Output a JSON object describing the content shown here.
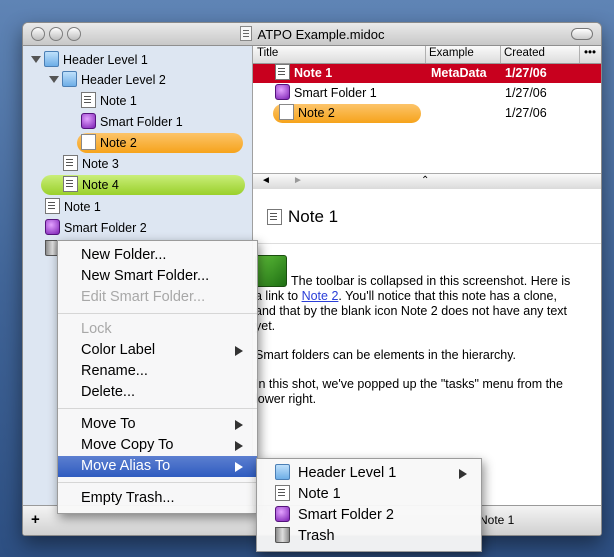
{
  "window": {
    "title": "ATPO Example.midoc"
  },
  "sidebar": {
    "items": [
      {
        "label": "Header Level 1",
        "icon": "folder-icon"
      },
      {
        "label": "Header Level 2",
        "icon": "folder-icon"
      },
      {
        "label": "Note 1",
        "icon": "note-icon"
      },
      {
        "label": "Smart Folder 1",
        "icon": "smart-folder-icon"
      },
      {
        "label": "Note 2",
        "icon": "blank-note-icon",
        "highlight": "#f6a31b"
      },
      {
        "label": "Note 3",
        "icon": "note-icon"
      },
      {
        "label": "Note 4",
        "icon": "note-icon",
        "highlight": "#9ad02b"
      },
      {
        "label": "Note 1",
        "icon": "note-icon"
      },
      {
        "label": "Smart Folder 2",
        "icon": "smart-folder-icon"
      }
    ]
  },
  "list": {
    "columns": [
      "Title",
      "Example",
      "Created",
      "•••"
    ],
    "rows": [
      {
        "title": "Note 1",
        "example": "MetaData",
        "created": "1/27/06",
        "selected": true,
        "color": "#c8001e"
      },
      {
        "title": "Smart Folder 1",
        "example": "",
        "created": "1/27/06"
      },
      {
        "title": "Note 2",
        "example": "",
        "created": "1/27/06",
        "highlight": "#f6a31b"
      }
    ],
    "scroll": {
      "left": "◄",
      "right": "►",
      "up": "⌃"
    }
  },
  "detail": {
    "title": "Note 1",
    "p1_pre": "The toolbar is collapsed in this screenshot. Here is a link to ",
    "p1_link": "Note 2",
    "p1_post": ". You'll notice that this note has a clone, and that by the blank icon Note 2 does not have any text yet.",
    "p2": "Smart folders can be elements in the hierarchy.",
    "p3": "In this shot, we've popped up the \"tasks\" menu from the lower right."
  },
  "bottom": {
    "add": "+",
    "status": "Note 1"
  },
  "context_menu": {
    "new_folder": "New Folder...",
    "new_smart_folder": "New Smart Folder...",
    "edit_smart_folder": "Edit Smart Folder...",
    "lock": "Lock",
    "color_label": "Color Label",
    "rename": "Rename...",
    "delete": "Delete...",
    "move_to": "Move To",
    "move_copy_to": "Move Copy To",
    "move_alias_to": "Move Alias To",
    "empty_trash": "Empty Trash..."
  },
  "submenu": {
    "items": [
      "Header Level 1",
      "Note 1",
      "Smart Folder 2",
      "Trash"
    ]
  },
  "colors": {
    "selection_red": "#c8001e",
    "label_orange": "#f6a31b",
    "label_green": "#9ad02b",
    "menu_highlight": "#2f5cc0"
  }
}
